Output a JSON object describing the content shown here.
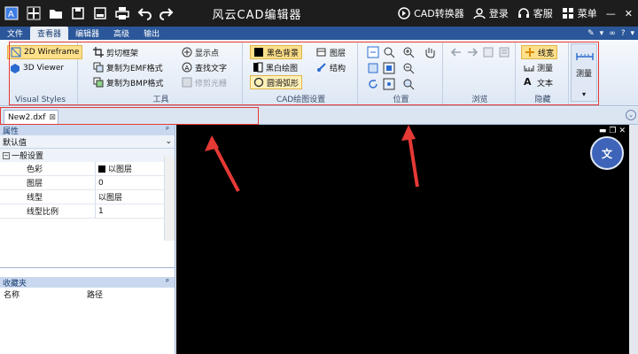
{
  "titlebar": {
    "title": "风云CAD编辑器",
    "cad_converter": "CAD转换器",
    "login": "登录",
    "support": "客服",
    "menu": "菜单"
  },
  "menubar": {
    "tabs": [
      "文件",
      "查看器",
      "编辑器",
      "高级",
      "输出"
    ]
  },
  "ribbon": {
    "visual_styles": {
      "wireframe": "2D Wireframe",
      "viewer3d": "3D Viewer",
      "label": "Visual Styles"
    },
    "tools": {
      "crop_frame": "剪切框架",
      "copy_emf": "复制为EMF格式",
      "copy_bmp": "复制为BMP格式",
      "show_points": "显示点",
      "find_text": "查找文字",
      "trim_raster": "修剪光栅",
      "label": "工具"
    },
    "cad_settings": {
      "black_bg": "黑色背景",
      "bw_draw": "黑白绘图",
      "smooth_arc": "圆滑弧形",
      "layers": "图层",
      "structure": "结构",
      "label": "CAD绘图设置"
    },
    "position": {
      "label": "位置"
    },
    "browse": {
      "label": "浏览"
    },
    "hide": {
      "line_width": "线宽",
      "measure": "测量",
      "text": "文本",
      "label": "隐藏"
    },
    "measure_big": "测量"
  },
  "doc_tab": {
    "name": "New2.dxf"
  },
  "properties": {
    "header": "属性",
    "dropdown_value": "默认值",
    "category": "一般设置",
    "rows": [
      {
        "key": "色彩",
        "value": "以图层"
      },
      {
        "key": "图层",
        "value": "0"
      },
      {
        "key": "线型",
        "value": "以图层"
      },
      {
        "key": "线型比例",
        "value": "1"
      }
    ]
  },
  "favorites": {
    "header": "收藏夹",
    "col_name": "名称",
    "col_path": "路径"
  },
  "colors": {
    "titlebar": "#1d1d1d",
    "menubar": "#2b579a",
    "canvas": "#000000",
    "annotation": "#e53935"
  }
}
